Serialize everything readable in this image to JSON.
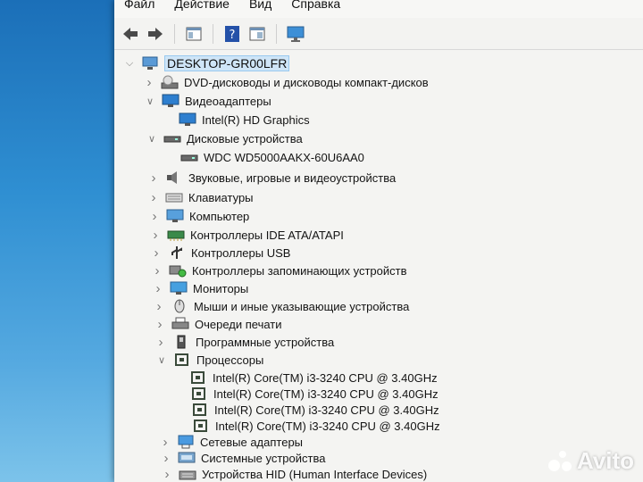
{
  "menu": [
    "Файл",
    "Действие",
    "Вид",
    "Справка"
  ],
  "toolbar": {
    "icons": [
      "back-arrow-icon",
      "forward-arrow-icon",
      "show-hide-tree-icon",
      "help-icon",
      "properties-icon",
      "monitor-icon"
    ]
  },
  "tree": {
    "root": "DESKTOP-GR00LFR",
    "nodes": [
      {
        "label": "DVD-дисководы и дисководы компакт-дисков",
        "expanded": false,
        "icon": "dvd-drive-icon"
      },
      {
        "label": "Видеоадаптеры",
        "expanded": true,
        "icon": "display-adapter-icon"
      },
      {
        "label": "Intel(R) HD Graphics",
        "icon": "display-adapter-icon",
        "child": true
      },
      {
        "label": "Дисковые устройства",
        "expanded": true,
        "icon": "disk-drive-icon"
      },
      {
        "label": "WDC WD5000AAKX-60U6AA0",
        "icon": "disk-drive-icon",
        "child": true
      },
      {
        "label": "Звуковые, игровые и видеоустройства",
        "expanded": false,
        "icon": "speaker-icon"
      },
      {
        "label": "Клавиатуры",
        "expanded": false,
        "icon": "keyboard-icon"
      },
      {
        "label": "Компьютер",
        "expanded": false,
        "icon": "computer-icon"
      },
      {
        "label": "Контроллеры IDE ATA/ATAPI",
        "expanded": false,
        "icon": "ide-controller-icon"
      },
      {
        "label": "Контроллеры USB",
        "expanded": false,
        "icon": "usb-icon"
      },
      {
        "label": "Контроллеры запоминающих устройств",
        "expanded": false,
        "icon": "storage-controller-icon"
      },
      {
        "label": "Мониторы",
        "expanded": false,
        "icon": "monitor-icon"
      },
      {
        "label": "Мыши и иные указывающие устройства",
        "expanded": false,
        "icon": "mouse-icon"
      },
      {
        "label": "Очереди печати",
        "expanded": false,
        "icon": "printer-icon"
      },
      {
        "label": "Программные устройства",
        "expanded": false,
        "icon": "software-device-icon"
      },
      {
        "label": "Процессоры",
        "expanded": true,
        "icon": "processor-icon"
      },
      {
        "label": "Intel(R) Core(TM) i3-3240 CPU @ 3.40GHz",
        "icon": "processor-icon",
        "child": true
      },
      {
        "label": "Intel(R) Core(TM) i3-3240 CPU @ 3.40GHz",
        "icon": "processor-icon",
        "child": true
      },
      {
        "label": "Intel(R) Core(TM) i3-3240 CPU @ 3.40GHz",
        "icon": "processor-icon",
        "child": true
      },
      {
        "label": "Intel(R) Core(TM) i3-3240 CPU @ 3.40GHz",
        "icon": "processor-icon",
        "child": true
      },
      {
        "label": "Сетевые адаптеры",
        "expanded": false,
        "icon": "network-adapter-icon"
      },
      {
        "label": "Системные устройства",
        "expanded": false,
        "icon": "system-device-icon"
      },
      {
        "label": "Устройства HID (Human Interface Devices)",
        "expanded": false,
        "icon": "hid-icon"
      }
    ]
  },
  "watermark": "Avito",
  "colors": {
    "desktop": "#2f8fd2",
    "selection": "#cfe5f7",
    "accent": "#1a6fc0"
  }
}
